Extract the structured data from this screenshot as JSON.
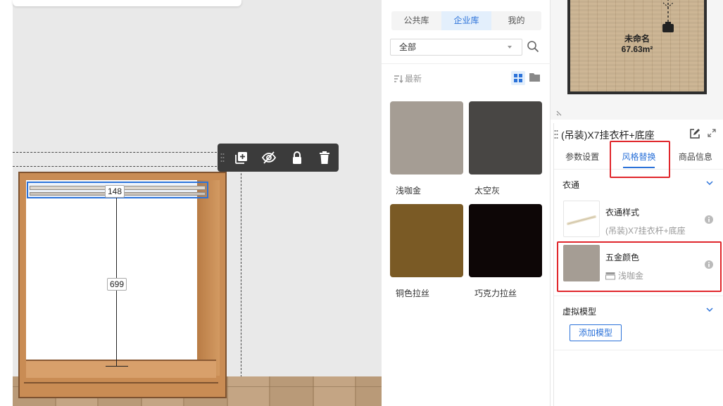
{
  "canvas": {
    "dimension_width": "148",
    "dimension_height": "699",
    "toolbar": {
      "grip_icon": "grip-icon",
      "copy_icon": "copy-add-icon",
      "hide_icon": "eye-off-icon",
      "lock_icon": "lock-icon",
      "delete_icon": "trash-icon"
    }
  },
  "library": {
    "tabs": [
      {
        "label": "公共库",
        "active": false
      },
      {
        "label": "企业库",
        "active": true
      },
      {
        "label": "我的",
        "active": false
      }
    ],
    "filter_value": "全部",
    "sort_label": "最新",
    "swatches": [
      {
        "label": "浅咖金",
        "color": "#a59d94"
      },
      {
        "label": "太空灰",
        "color": "#484644"
      },
      {
        "label": "铜色拉丝",
        "color": "#7a5a25"
      },
      {
        "label": "巧克力拉丝",
        "color": "#0d0606"
      }
    ]
  },
  "minimap": {
    "room_name": "未命名",
    "room_area": "67.63m²"
  },
  "properties": {
    "title": "(吊装)X7挂衣杆+底座",
    "tabs": [
      {
        "label": "参数设置",
        "active": false
      },
      {
        "label": "风格替换",
        "active": true
      },
      {
        "label": "商品信息",
        "active": false
      }
    ],
    "section_rail": {
      "title": "衣通",
      "items": [
        {
          "title": "衣通样式",
          "subtitle": "(吊装)X7挂衣杆+底座"
        },
        {
          "title": "五金颜色",
          "subtitle": "浅咖金",
          "color": "#a59d94"
        }
      ]
    },
    "section_virtual": {
      "title": "虚拟模型",
      "add_button": "添加模型"
    }
  },
  "colors": {
    "accent": "#2b72d9",
    "highlight_red": "#e0262b"
  }
}
